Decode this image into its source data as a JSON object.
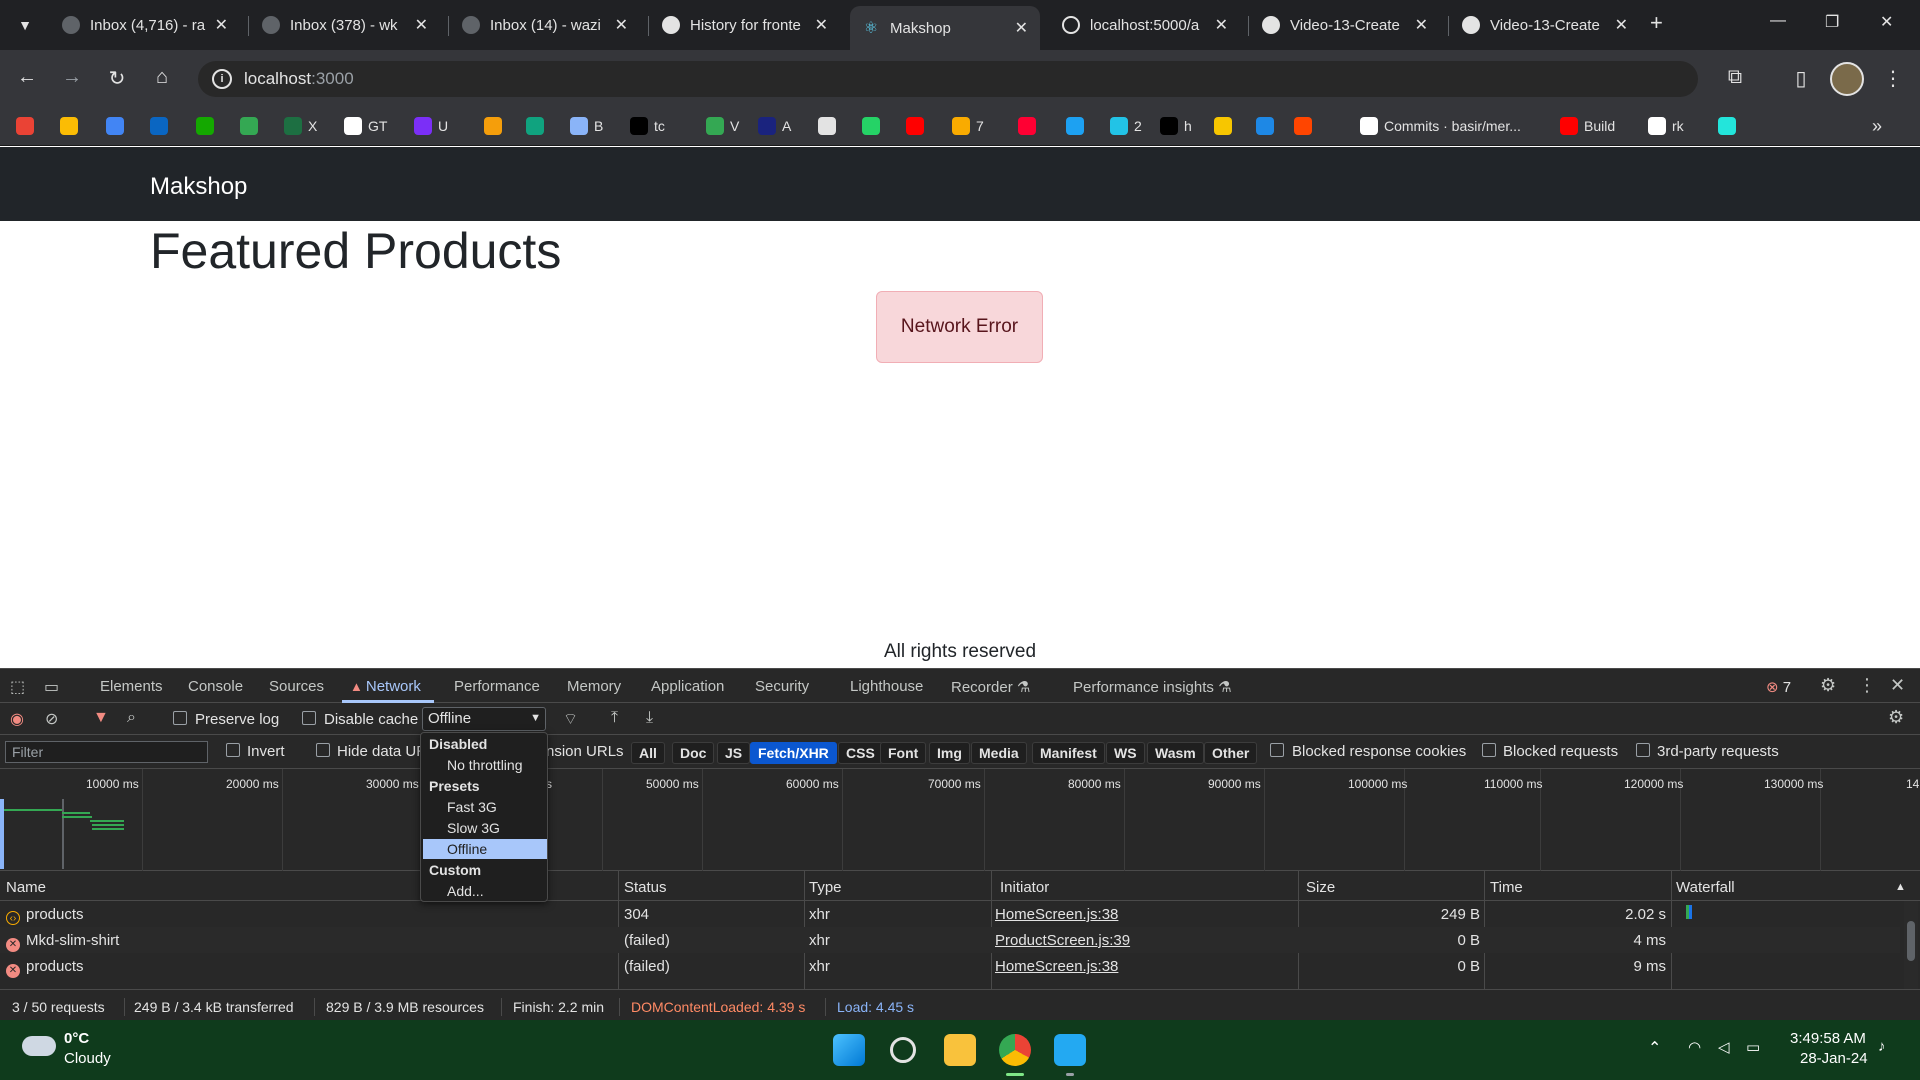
{
  "browser": {
    "tabs": [
      {
        "title": "Inbox (4,716) - ra",
        "active": false
      },
      {
        "title": "Inbox (378) - wk",
        "active": false
      },
      {
        "title": "Inbox (14) - wazi",
        "active": false
      },
      {
        "title": "History for fronte",
        "active": false
      },
      {
        "title": "Makshop",
        "active": true
      },
      {
        "title": "localhost:5000/a",
        "active": false
      },
      {
        "title": "Video-13-Create",
        "active": false
      },
      {
        "title": "Video-13-Create",
        "active": false
      }
    ],
    "address": {
      "host": "localhost",
      "port": ":3000"
    },
    "bookmarks": [
      {
        "label": "",
        "color": "#ea4335"
      },
      {
        "label": "",
        "color": "#fbbc04"
      },
      {
        "label": "",
        "color": "#4285f4"
      },
      {
        "label": "",
        "color": "#0a66c2"
      },
      {
        "label": "",
        "color": "#14a800"
      },
      {
        "label": "",
        "color": "#34a853"
      },
      {
        "label": "X",
        "color": "#1d6f42"
      },
      {
        "label": "GT",
        "color": "#ffffff"
      },
      {
        "label": "U",
        "color": "#7b2ff7"
      },
      {
        "label": "",
        "color": "#f59e0b"
      },
      {
        "label": "",
        "color": "#10a37f"
      },
      {
        "label": "B",
        "color": "#8ab4f8"
      },
      {
        "label": "tc",
        "color": "#000000"
      },
      {
        "label": "V",
        "color": "#34a853"
      },
      {
        "label": "A",
        "color": "#1a237e"
      },
      {
        "label": "",
        "color": "#e3e3e3"
      },
      {
        "label": "",
        "color": "#25d366"
      },
      {
        "label": "",
        "color": "#ff0000"
      },
      {
        "label": "7",
        "color": "#f9ab00"
      },
      {
        "label": "",
        "color": "#ff0033"
      },
      {
        "label": "",
        "color": "#1da1f2"
      },
      {
        "label": "2",
        "color": "#22c3e6"
      },
      {
        "label": "h",
        "color": "#000000"
      },
      {
        "label": "",
        "color": "#f7c600"
      },
      {
        "label": "",
        "color": "#1e88e5"
      },
      {
        "label": "",
        "color": "#ff4500"
      },
      {
        "label": "Commits · basir/mer...",
        "color": "#ffffff"
      },
      {
        "label": "Build",
        "color": "#ff0000"
      },
      {
        "label": "rk",
        "color": "#ffffff"
      },
      {
        "label": "",
        "color": "#23e5db"
      }
    ]
  },
  "page": {
    "brand": "Makshop",
    "title": "Featured Products",
    "alert": "Network Error",
    "footer": "All rights reserved"
  },
  "devtools": {
    "tabs": [
      "Elements",
      "Console",
      "Sources",
      "Network",
      "Performance",
      "Memory",
      "Application",
      "Security",
      "Lighthouse",
      "Recorder",
      "Performance insights"
    ],
    "active_tab": "Network",
    "error_count": "7",
    "toolbar": {
      "preserve_log": "Preserve log",
      "disable_cache": "Disable cache",
      "throttle_value": "Offline"
    },
    "filterbar": {
      "placeholder": "Filter",
      "invert": "Invert",
      "hide_data_urls": "Hide data URLs",
      "ext_urls_tail": "nsion URLs",
      "chips": [
        "All",
        "Doc",
        "JS",
        "Fetch/XHR",
        "CSS",
        "Font",
        "Img",
        "Media",
        "Manifest",
        "WS",
        "Wasm",
        "Other"
      ],
      "selected_chip": "Fetch/XHR",
      "blocked_cookies": "Blocked response cookies",
      "blocked_requests": "Blocked requests",
      "third_party": "3rd-party requests"
    },
    "timeline_ticks": [
      "10000 ms",
      "20000 ms",
      "30000 ms",
      "s",
      "50000 ms",
      "60000 ms",
      "70000 ms",
      "80000 ms",
      "90000 ms",
      "100000 ms",
      "110000 ms",
      "120000 ms",
      "130000 ms",
      "14"
    ],
    "throttle_menu": {
      "groups": [
        {
          "header": "Disabled",
          "items": [
            "No throttling"
          ]
        },
        {
          "header": "Presets",
          "items": [
            "Fast 3G",
            "Slow 3G",
            "Offline"
          ]
        },
        {
          "header": "Custom",
          "items": [
            "Add..."
          ]
        }
      ],
      "selected": "Offline"
    },
    "columns": [
      "Name",
      "Status",
      "Type",
      "Initiator",
      "Size",
      "Time",
      "Waterfall"
    ],
    "requests": [
      {
        "name": "products",
        "status": "304",
        "type": "xhr",
        "initiator": "HomeScreen.js:38",
        "size": "249 B",
        "time": "2.02 s",
        "failed": false
      },
      {
        "name": "Mkd-slim-shirt",
        "status": "(failed)",
        "type": "xhr",
        "initiator": "ProductScreen.js:39",
        "size": "0 B",
        "time": "4 ms",
        "failed": true
      },
      {
        "name": "products",
        "status": "(failed)",
        "type": "xhr",
        "initiator": "HomeScreen.js:38",
        "size": "0 B",
        "time": "9 ms",
        "failed": true
      }
    ],
    "summary": {
      "requests": "3 / 50 requests",
      "transferred": "249 B / 3.4 kB transferred",
      "resources": "829 B / 3.9 MB resources",
      "finish": "Finish: 2.2 min",
      "dcl": "DOMContentLoaded: 4.39 s",
      "load": "Load: 4.45 s"
    },
    "colors": {
      "dcl": "#ff8a65",
      "load": "#8ab4f8",
      "error": "#f28b82",
      "accent": "#a8c7fa"
    }
  },
  "taskbar": {
    "weather_temp": "0°C",
    "weather_desc": "Cloudy",
    "time": "3:49:58 AM",
    "date": "28-Jan-24"
  }
}
